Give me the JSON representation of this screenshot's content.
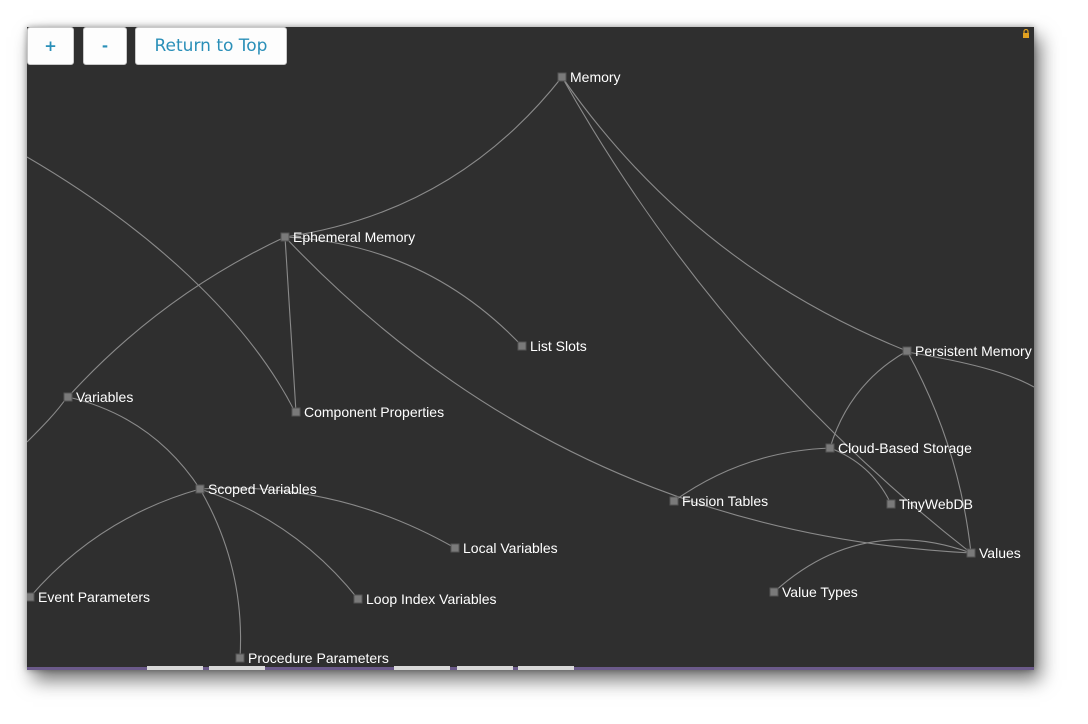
{
  "toolbar": {
    "zoom_in_label": "+",
    "zoom_out_label": "-",
    "return_top_label": "Return to Top"
  },
  "nodes": [
    {
      "id": "memory",
      "label": "Memory"
    },
    {
      "id": "ephemeral",
      "label": "Ephemeral Memory"
    },
    {
      "id": "listslots",
      "label": "List Slots"
    },
    {
      "id": "persistent",
      "label": "Persistent Memory"
    },
    {
      "id": "variables",
      "label": "Variables"
    },
    {
      "id": "component",
      "label": "Component Properties"
    },
    {
      "id": "cloud",
      "label": "Cloud-Based Storage"
    },
    {
      "id": "scoped",
      "label": "Scoped Variables"
    },
    {
      "id": "fusion",
      "label": "Fusion Tables"
    },
    {
      "id": "tinywebdb",
      "label": "TinyWebDB"
    },
    {
      "id": "local",
      "label": "Local Variables"
    },
    {
      "id": "values",
      "label": "Values"
    },
    {
      "id": "event",
      "label": "Event Parameters"
    },
    {
      "id": "loop",
      "label": "Loop Index Variables"
    },
    {
      "id": "valuetypes",
      "label": "Value Types"
    },
    {
      "id": "procedure",
      "label": "Procedure Parameters"
    }
  ],
  "edges": [
    [
      "memory",
      "ephemeral"
    ],
    [
      "memory",
      "persistent"
    ],
    [
      "memory",
      "values"
    ],
    [
      "ephemeral",
      "listslots"
    ],
    [
      "ephemeral",
      "variables"
    ],
    [
      "ephemeral",
      "component"
    ],
    [
      "ephemeral",
      "values"
    ],
    [
      "persistent",
      "cloud"
    ],
    [
      "persistent",
      "values"
    ],
    [
      "cloud",
      "fusion"
    ],
    [
      "cloud",
      "tinywebdb"
    ],
    [
      "variables",
      "scoped"
    ],
    [
      "scoped",
      "local"
    ],
    [
      "scoped",
      "loop"
    ],
    [
      "scoped",
      "event"
    ],
    [
      "scoped",
      "procedure"
    ],
    [
      "values",
      "valuetypes"
    ]
  ],
  "colors": {
    "background": "#2f2f2f",
    "edge": "#8a8a8a",
    "node": "#7a7a7a",
    "label": "#ffffff",
    "button_text": "#2a8fb8"
  }
}
